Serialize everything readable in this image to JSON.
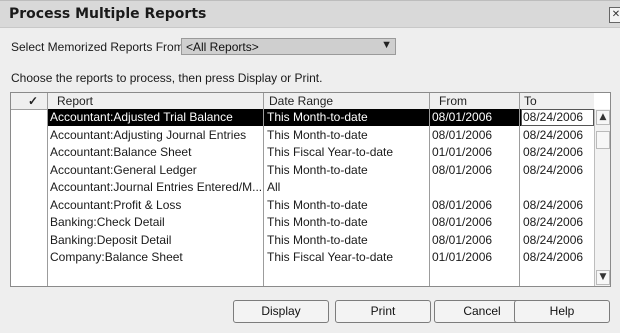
{
  "window": {
    "title": "Process Multiple Reports"
  },
  "select": {
    "label": "Select Memorized Reports From",
    "value": "<All Reports>"
  },
  "instructions": "Choose the reports to process, then press Display or Print.",
  "table": {
    "headers": {
      "check": "✓",
      "report": "Report",
      "range": "Date Range",
      "from": "From",
      "to": "To"
    },
    "rows": [
      {
        "report": "Accountant:Adjusted Trial Balance",
        "range": "This Month-to-date",
        "from": "08/01/2006",
        "to": "08/24/2006",
        "selected": true
      },
      {
        "report": "Accountant:Adjusting Journal Entries",
        "range": "This Month-to-date",
        "from": "08/01/2006",
        "to": "08/24/2006"
      },
      {
        "report": "Accountant:Balance Sheet",
        "range": "This Fiscal Year-to-date",
        "from": "01/01/2006",
        "to": "08/24/2006"
      },
      {
        "report": "Accountant:General Ledger",
        "range": "This Month-to-date",
        "from": "08/01/2006",
        "to": "08/24/2006"
      },
      {
        "report": "Accountant:Journal Entries Entered/M...",
        "range": "All",
        "from": "",
        "to": ""
      },
      {
        "report": "Accountant:Profit & Loss",
        "range": "This Month-to-date",
        "from": "08/01/2006",
        "to": "08/24/2006"
      },
      {
        "report": "Banking:Check Detail",
        "range": "This Month-to-date",
        "from": "08/01/2006",
        "to": "08/24/2006"
      },
      {
        "report": "Banking:Deposit Detail",
        "range": "This Month-to-date",
        "from": "08/01/2006",
        "to": "08/24/2006"
      },
      {
        "report": "Company:Balance Sheet",
        "range": "This Fiscal Year-to-date",
        "from": "01/01/2006",
        "to": "08/24/2006"
      }
    ]
  },
  "buttons": {
    "display": "Display",
    "print": "Print",
    "cancel": "Cancel",
    "help": "Help"
  }
}
